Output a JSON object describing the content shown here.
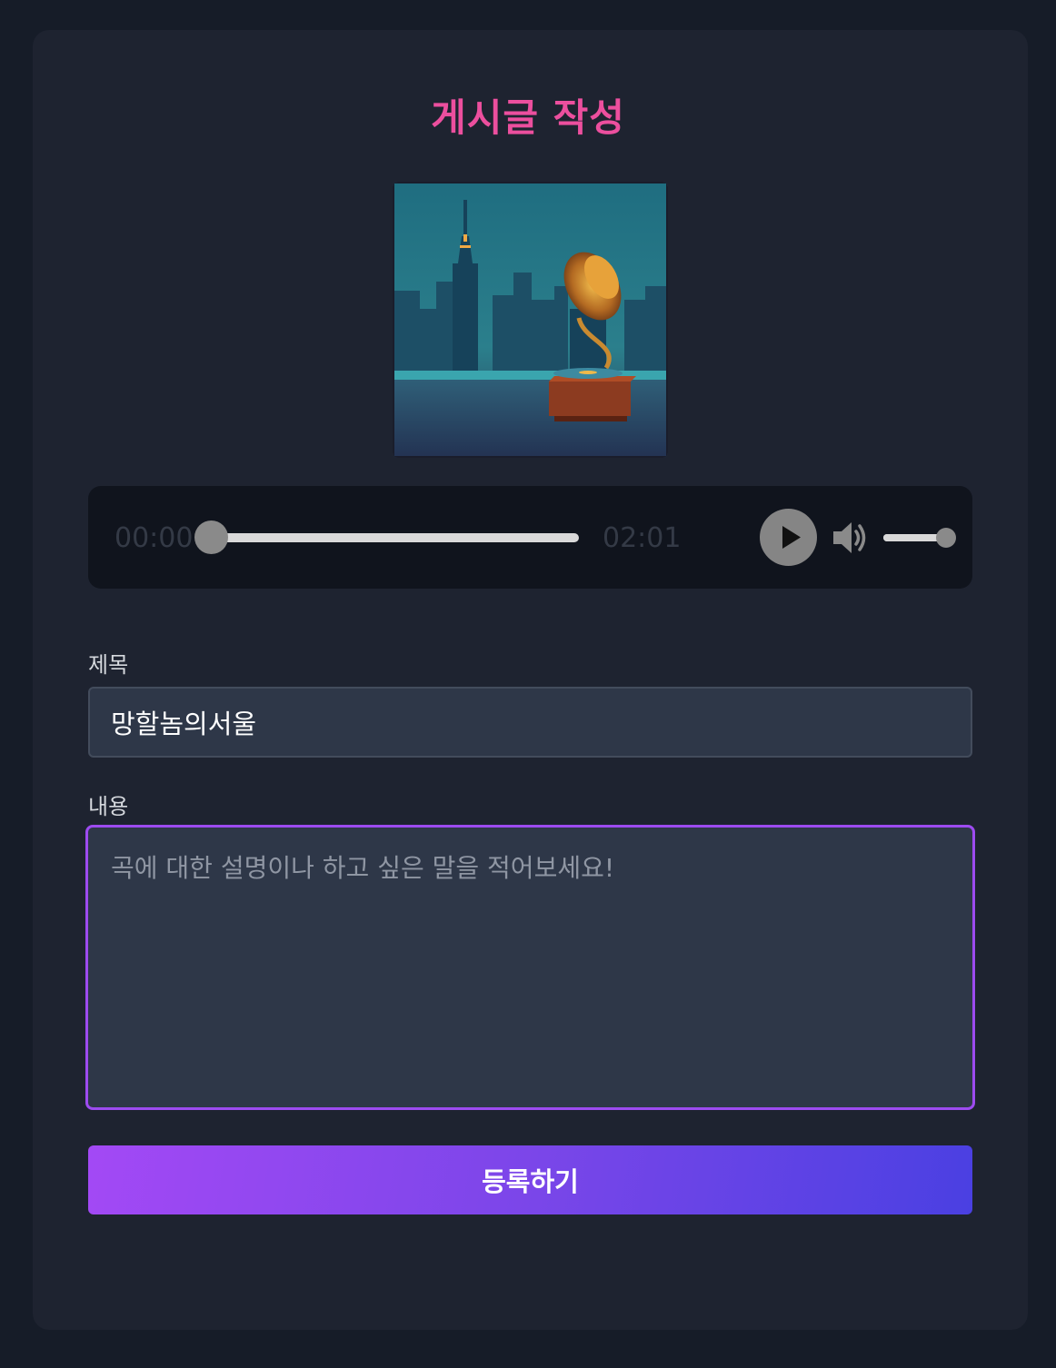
{
  "page": {
    "title": "게시글 작성"
  },
  "colors": {
    "accent_title": "#ec4f9e",
    "focus_border": "#9d4bf0",
    "button_gradient_start": "#a349f5",
    "button_gradient_end": "#4a40e2"
  },
  "cover": {
    "icon": "album-cover-image"
  },
  "player": {
    "current_time": "00:00",
    "total_time": "02:01",
    "progress": 0.0,
    "volume": 1.0,
    "play_icon": "play-icon",
    "volume_icon": "volume-icon"
  },
  "form": {
    "title_label": "제목",
    "title_value": "망할놈의서울",
    "content_label": "내용",
    "content_placeholder": "곡에 대한 설명이나 하고 싶은 말을 적어보세요!",
    "content_value": "",
    "submit_label": "등록하기"
  }
}
